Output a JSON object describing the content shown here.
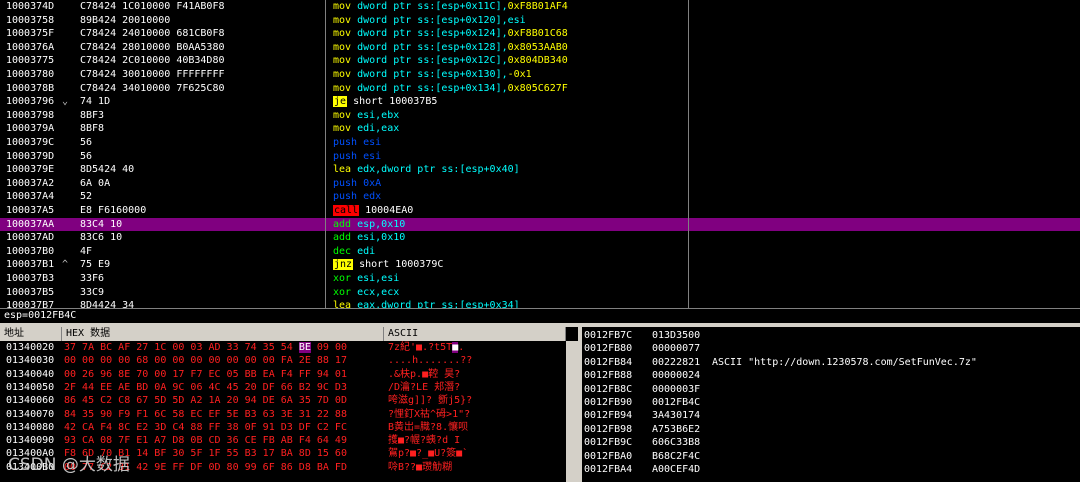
{
  "disasm": [
    {
      "addr": "1000374D",
      "mark": "",
      "hex": "C78424 1C010000 F41AB0F8",
      "mnem": "mov",
      "ops": "dword ptr ss:[esp+0x11C],",
      "imm": "0xF8B01AF4",
      "kind": "mov"
    },
    {
      "addr": "10003758",
      "mark": "",
      "hex": "89B424 20010000",
      "mnem": "mov",
      "ops": "dword ptr ss:[esp+0x120],esi",
      "imm": "",
      "kind": "mov"
    },
    {
      "addr": "1000375F",
      "mark": "",
      "hex": "C78424 24010000 681CB0F8",
      "mnem": "mov",
      "ops": "dword ptr ss:[esp+0x124],",
      "imm": "0xF8B01C68",
      "kind": "mov"
    },
    {
      "addr": "1000376A",
      "mark": "",
      "hex": "C78424 28010000 B0AA5380",
      "mnem": "mov",
      "ops": "dword ptr ss:[esp+0x128],",
      "imm": "0x8053AAB0",
      "kind": "mov"
    },
    {
      "addr": "10003775",
      "mark": "",
      "hex": "C78424 2C010000 40B34D80",
      "mnem": "mov",
      "ops": "dword ptr ss:[esp+0x12C],",
      "imm": "0x804DB340",
      "kind": "mov"
    },
    {
      "addr": "10003780",
      "mark": "",
      "hex": "C78424 30010000 FFFFFFFF",
      "mnem": "mov",
      "ops": "dword ptr ss:[esp+0x130],",
      "imm": "-0x1",
      "kind": "mov"
    },
    {
      "addr": "1000378B",
      "mark": "",
      "hex": "C78424 34010000 7F625C80",
      "mnem": "mov",
      "ops": "dword ptr ss:[esp+0x134],",
      "imm": "0x805C627F",
      "kind": "mov"
    },
    {
      "addr": "10003796",
      "mark": "⌄",
      "hex": "74 1D",
      "mnem": "je",
      "ops": "short 100037B5",
      "imm": "",
      "kind": "jmp"
    },
    {
      "addr": "10003798",
      "mark": "",
      "hex": "8BF3",
      "mnem": "mov",
      "ops": "esi,ebx",
      "imm": "",
      "kind": "mov"
    },
    {
      "addr": "1000379A",
      "mark": "",
      "hex": "8BF8",
      "mnem": "mov",
      "ops": "edi,eax",
      "imm": "",
      "kind": "mov"
    },
    {
      "addr": "1000379C",
      "mark": "",
      "hex": "56",
      "mnem": "push",
      "ops": "esi",
      "imm": "",
      "kind": "push"
    },
    {
      "addr": "1000379D",
      "mark": "",
      "hex": "56",
      "mnem": "push",
      "ops": "esi",
      "imm": "",
      "kind": "push"
    },
    {
      "addr": "1000379E",
      "mark": "",
      "hex": "8D5424 40",
      "mnem": "lea",
      "ops": "edx,dword ptr ss:[esp+0x40]",
      "imm": "",
      "kind": "lea"
    },
    {
      "addr": "100037A2",
      "mark": "",
      "hex": "6A 0A",
      "mnem": "push",
      "ops": "0xA",
      "imm": "",
      "kind": "push"
    },
    {
      "addr": "100037A4",
      "mark": "",
      "hex": "52",
      "mnem": "push",
      "ops": "edx",
      "imm": "",
      "kind": "push"
    },
    {
      "addr": "100037A5",
      "mark": "",
      "hex": "E8 F6160000",
      "mnem": "call",
      "ops": "10004EA0",
      "imm": "",
      "kind": "call"
    },
    {
      "addr": "100037AA",
      "mark": "",
      "hex": "83C4 10",
      "mnem": "add",
      "ops": "esp,0x10",
      "imm": "",
      "kind": "add"
    },
    {
      "addr": "100037AD",
      "mark": "",
      "hex": "83C6 10",
      "mnem": "add",
      "ops": "esi,0x10",
      "imm": "",
      "kind": "add"
    },
    {
      "addr": "100037B0",
      "mark": "",
      "hex": "4F",
      "mnem": "dec",
      "ops": "edi",
      "imm": "",
      "kind": "dec"
    },
    {
      "addr": "100037B1",
      "mark": "^",
      "hex": "75 E9",
      "mnem": "jnz",
      "ops": "short 1000379C",
      "imm": "",
      "kind": "jmp"
    },
    {
      "addr": "100037B3",
      "mark": "",
      "hex": "33F6",
      "mnem": "xor",
      "ops": "esi,esi",
      "imm": "",
      "kind": "xor"
    },
    {
      "addr": "100037B5",
      "mark": "",
      "hex": "33C9",
      "mnem": "xor",
      "ops": "ecx,ecx",
      "imm": "",
      "kind": "xor"
    },
    {
      "addr": "100037B7",
      "mark": "",
      "hex": "8D4424 34",
      "mnem": "lea",
      "ops": "eax,dword ptr ss:[esp+0x34]",
      "imm": "",
      "kind": "lea"
    }
  ],
  "selected_row": 16,
  "info_line": "esp=0012FB4C",
  "dump": {
    "headers": {
      "addr": "地址",
      "hex": "HEX 数据",
      "ascii": "ASCII"
    },
    "rows": [
      {
        "addr": "01340020",
        "hex": "37 7A BC AF 27 1C 00 03 AD 33 74 35 54",
        "hl": "BE",
        "tail": "09 00",
        "ascii": "7z紀'■.?t5T",
        "asc_hl": "■",
        "asc_tail": "."
      },
      {
        "addr": "01340030",
        "hex": "00 00 00 00 68 00 00 00 00 00 00 00 FA 2E 88 17",
        "hl": "",
        "tail": "",
        "ascii": "....h.......??",
        "asc_hl": "",
        "asc_tail": ""
      },
      {
        "addr": "01340040",
        "hex": "00 26 96 8E 70 00 17 F7 EC 05 BB EA F4 FF 94 01",
        "hl": "",
        "tail": "",
        "ascii": ".&枎p.■鞚 昊?",
        "asc_hl": "",
        "asc_tail": ""
      },
      {
        "addr": "01340050",
        "hex": "2F 44 EE AE BD 0A 9C 06 4C 45 20 DF 66 B2 9C D3",
        "hl": "",
        "tail": "",
        "ascii": "/D瀹?LE 邞潛?",
        "asc_hl": "",
        "asc_tail": ""
      },
      {
        "addr": "01340060",
        "hex": "86 45 C2 C8 67 5D 5D A2 1A 20 94 DE 6A 35 7D 0D",
        "hl": "",
        "tail": "",
        "ascii": "咵滋g]]? 斵j5}?",
        "asc_hl": "",
        "asc_tail": ""
      },
      {
        "addr": "01340070",
        "hex": "84 35 90 F9 F1 6C 58 EC EF 5E B3 63 3E 31 22 88",
        "hl": "",
        "tail": "",
        "ascii": "?悝釘X祜^砪>1\"?",
        "asc_hl": "",
        "asc_tail": ""
      },
      {
        "addr": "01340080",
        "hex": "42 CA F4 8C E2 3D C4 88 FF 38 0F 91 D3 DF C2 FC",
        "hl": "",
        "tail": "",
        "ascii": "B黄岀=膱?8.懹呗",
        "asc_hl": "",
        "asc_tail": ""
      },
      {
        "addr": "01340090",
        "hex": "93 CA 08 7F E1 A7 D8 0B CD 36 CE FB AB F4 64 49",
        "hl": "",
        "tail": "",
        "ascii": "擭■?幄?蛦?d I",
        "asc_hl": "",
        "asc_tail": ""
      },
      {
        "addr": "013400A0",
        "hex": "F8 6D 70 B1 14 BF 30 5F 1F 55 B3 17 BA 8D 15 60",
        "hl": "",
        "tail": "",
        "ascii": "鴐p?■?_■U?簽■`",
        "asc_hl": "",
        "asc_tail": ""
      },
      {
        "addr": "013400B0",
        "hex": "00 77 C2 31 42 9E FF DF 0D 80 99 6F 86 D8 BA FD",
        "hl": "",
        "tail": "",
        "ascii": "唥B??■瓒觔糊",
        "asc_hl": "",
        "asc_tail": ""
      }
    ]
  },
  "stack": [
    {
      "addr": "0012FB7C",
      "val": "013D3500",
      "comment": ""
    },
    {
      "addr": "0012FB80",
      "val": "00000077",
      "comment": ""
    },
    {
      "addr": "0012FB84",
      "val": "00222821",
      "comment": "ASCII \"http://down.1230578.com/SetFunVec.7z\""
    },
    {
      "addr": "0012FB88",
      "val": "00000024",
      "comment": ""
    },
    {
      "addr": "0012FB8C",
      "val": "0000003F",
      "comment": ""
    },
    {
      "addr": "0012FB90",
      "val": "0012FB4C",
      "comment": ""
    },
    {
      "addr": "0012FB94",
      "val": "3A430174",
      "comment": ""
    },
    {
      "addr": "0012FB98",
      "val": "A753B6E2",
      "comment": ""
    },
    {
      "addr": "0012FB9C",
      "val": "606C33B8",
      "comment": ""
    },
    {
      "addr": "0012FBA0",
      "val": "B68C2F4C",
      "comment": ""
    },
    {
      "addr": "0012FBA4",
      "val": "A00CEF4D",
      "comment": ""
    }
  ],
  "watermark": "CSDN @大数据",
  "colors": {
    "select": "#800080",
    "mov": "#ffff00",
    "operand": "#00ffff",
    "push": "#0050ff",
    "green": "#00ff00",
    "dump_text": "#ff2020",
    "header_bg": "#d4d0c8"
  }
}
